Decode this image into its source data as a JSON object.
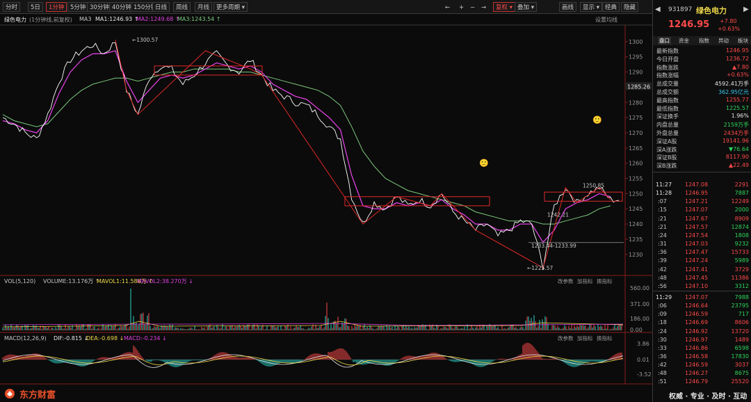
{
  "toolbar": {
    "periods": [
      "分时",
      "5日",
      "1分钟",
      "5分钟",
      "30分钟",
      "40分钟",
      "150分钟",
      "日线",
      "周线",
      "月线",
      "更多周期"
    ],
    "active_period": "1分钟",
    "right_buttons": [
      "复权",
      "叠加",
      "画线",
      "显示",
      "经典",
      "隐藏"
    ],
    "active_right": "复权"
  },
  "header": {
    "name": "绿色电力",
    "subtitle": "(1分钟线,前复权)",
    "ma": [
      {
        "label": "MA3",
        "value": ""
      },
      {
        "label": "MA1:",
        "value": "1246.93"
      },
      {
        "label": "MA2:",
        "value": "1249.68"
      },
      {
        "label": "MA3:",
        "value": "1243.54"
      }
    ],
    "settings": "设置均线"
  },
  "chart_data": [
    {
      "type": "line",
      "title": "绿色电力",
      "ylim": [
        1225,
        1303
      ],
      "yticks": [
        1300,
        1295,
        1290,
        1285,
        1280,
        1275,
        1270,
        1265,
        1260,
        1255,
        1250,
        1245,
        1240,
        1235,
        1230
      ],
      "price_label": "1285.26",
      "annotations": [
        "1300.57",
        "1225.57",
        "1233.44-1233.99",
        "1250.85",
        "1242.21"
      ],
      "emoji_marks": [
        "🙂",
        "🙂"
      ],
      "series": [
        {
          "name": "MA1",
          "color": "#ffffff"
        },
        {
          "name": "MA2",
          "color": "#e040e0"
        },
        {
          "name": "MA3",
          "color": "#7cc97c"
        }
      ],
      "price_path": [
        1275,
        1273,
        1270,
        1268,
        1276,
        1287,
        1294,
        1297,
        1299,
        1296,
        1300,
        1284,
        1276,
        1288,
        1292,
        1291,
        1286,
        1289,
        1293,
        1296,
        1292,
        1290,
        1294,
        1289,
        1284,
        1282,
        1280,
        1279,
        1276,
        1272,
        1268,
        1249,
        1240,
        1247,
        1245,
        1249,
        1246,
        1248,
        1246,
        1250,
        1244,
        1241,
        1238,
        1240,
        1236,
        1238,
        1241,
        1240,
        1226,
        1246,
        1252,
        1247,
        1250,
        1252,
        1248
      ],
      "ma2_path": [
        1274,
        1273,
        1271,
        1270,
        1274,
        1283,
        1290,
        1294,
        1296,
        1296,
        1297,
        1287,
        1280,
        1284,
        1288,
        1289,
        1288,
        1289,
        1291,
        1293,
        1292,
        1291,
        1292,
        1290,
        1286,
        1284,
        1282,
        1281,
        1278,
        1275,
        1271,
        1256,
        1246,
        1245,
        1245,
        1247,
        1246,
        1247,
        1246,
        1248,
        1245,
        1243,
        1240,
        1240,
        1238,
        1238,
        1240,
        1240,
        1234,
        1238,
        1245,
        1247,
        1248,
        1250,
        1249
      ],
      "ma3_path": [
        1276,
        1274,
        1273,
        1272,
        1273,
        1277,
        1281,
        1284,
        1286,
        1287,
        1288,
        1288,
        1287,
        1288,
        1289,
        1290,
        1290,
        1291,
        1291,
        1291,
        1291,
        1290,
        1290,
        1289,
        1288,
        1287,
        1286,
        1285,
        1284,
        1282,
        1279,
        1272,
        1264,
        1259,
        1255,
        1253,
        1251,
        1250,
        1249,
        1248,
        1247,
        1246,
        1244,
        1243,
        1242,
        1241,
        1241,
        1241,
        1240,
        1240,
        1241,
        1242,
        1243,
        1245,
        1246
      ]
    },
    {
      "type": "bar",
      "title": "VOL(5,120)",
      "legend": [
        {
          "label": "VOLUME:",
          "value": "13.176万",
          "color": "#c8c8c8"
        },
        {
          "label": "MAVOL1:",
          "value": "11.586万",
          "color": "#f0d94a"
        },
        {
          "label": "MAVOL2:",
          "value": "38.270万",
          "color": "#e040e0"
        }
      ],
      "yticks": [
        "560.00",
        "371.00",
        "186.00",
        "0.00"
      ],
      "tools": [
        "改参数",
        "加指标",
        "换指标"
      ]
    },
    {
      "type": "bar",
      "title": "MACD(12,26,9)",
      "legend": [
        {
          "label": "DIF:",
          "value": "-0.815",
          "color": "#e8e8e8"
        },
        {
          "label": "DEA:",
          "value": "-0.698",
          "color": "#f0d94a"
        },
        {
          "label": "MACD:",
          "value": "-0.234",
          "color": "#e040e0"
        }
      ],
      "yticks": [
        "3.86",
        "0.01",
        "-3.52"
      ],
      "tools": [
        "改参数",
        "加指标",
        "换指标"
      ]
    }
  ],
  "quote": {
    "code": "931897",
    "name": "绿色电力",
    "price": "1246.95",
    "change": "+7.80",
    "change_pct": "+0.63%",
    "tabs": [
      "盘口",
      "资金",
      "指数",
      "异动",
      "板块"
    ],
    "rows": [
      {
        "k": "最新指数",
        "v": "1246.95",
        "c": "red"
      },
      {
        "k": "今日开盘",
        "v": "1236.72",
        "c": "red"
      },
      {
        "k": "指数涨跌",
        "v": "▲7.80",
        "c": "red"
      },
      {
        "k": "指数涨幅",
        "v": "+0.63%",
        "c": "red"
      },
      {
        "k": "总成交量",
        "v": "4592.41万手",
        "c": "white"
      },
      {
        "k": "总成交额",
        "v": "362.95亿元",
        "c": "cyan"
      },
      {
        "k": "最高指数",
        "v": "1255.77",
        "c": "red"
      },
      {
        "k": "最低指数",
        "v": "1225.57",
        "c": "green"
      },
      {
        "k": "深证换手",
        "v": "1.96%",
        "c": "white"
      },
      {
        "k": "内盘总量",
        "v": "2159万手",
        "c": "green"
      },
      {
        "k": "外盘总量",
        "v": "2434万手",
        "c": "red"
      },
      {
        "k": "深证A股",
        "v": "19141.96",
        "c": "red"
      },
      {
        "k": "深A涨跌",
        "v": "▼76.64",
        "c": "green"
      },
      {
        "k": "深证B股",
        "v": "8117.90",
        "c": "red"
      },
      {
        "k": "深B涨跌",
        "v": "▲22.49",
        "c": "red"
      }
    ],
    "ticks": [
      {
        "t": "11:27",
        "p": "1247.08",
        "q": "2291",
        "c": "red"
      },
      {
        "t": "11:28",
        "p": "1246.95",
        "q": "7887",
        "c": "green"
      },
      {
        "t": ":07",
        "p": "1247.21",
        "q": "12249",
        "c": "red"
      },
      {
        "t": ":15",
        "p": "1247.07",
        "q": "2000",
        "c": "green"
      },
      {
        "t": ":21",
        "p": "1247.67",
        "q": "8909",
        "c": "red"
      },
      {
        "t": ":21",
        "p": "1247.57",
        "q": "12874",
        "c": "green"
      },
      {
        "t": ":24",
        "p": "1247.54",
        "q": "1808",
        "c": "green"
      },
      {
        "t": ":31",
        "p": "1247.03",
        "q": "9232",
        "c": "green"
      },
      {
        "t": ":36",
        "p": "1247.47",
        "q": "15733",
        "c": "red"
      },
      {
        "t": ":39",
        "p": "1247.24",
        "q": "5989",
        "c": "green"
      },
      {
        "t": ":42",
        "p": "1247.41",
        "q": "3729",
        "c": "red"
      },
      {
        "t": ":48",
        "p": "1247.45",
        "q": "11386",
        "c": "red"
      },
      {
        "t": ":56",
        "p": "1247.10",
        "q": "3312",
        "c": "green"
      },
      {
        "t": "11:29",
        "p": "1247.07",
        "q": "7988",
        "c": "green"
      },
      {
        "t": ":06",
        "p": "1246.64",
        "q": "23795",
        "c": "green"
      },
      {
        "t": ":09",
        "p": "1246.59",
        "q": "717",
        "c": "green"
      },
      {
        "t": ":18",
        "p": "1246.69",
        "q": "8606",
        "c": "red"
      },
      {
        "t": ":24",
        "p": "1246.92",
        "q": "13720",
        "c": "red"
      },
      {
        "t": ":30",
        "p": "1246.97",
        "q": "1489",
        "c": "red"
      },
      {
        "t": ":33",
        "p": "1246.86",
        "q": "6598",
        "c": "green"
      },
      {
        "t": ":36",
        "p": "1246.58",
        "q": "17830",
        "c": "green"
      },
      {
        "t": ":42",
        "p": "1246.59",
        "q": "3037",
        "c": "red"
      },
      {
        "t": ":48",
        "p": "1246.27",
        "q": "8675",
        "c": "green"
      },
      {
        "t": ":51",
        "p": "1246.79",
        "q": "25520",
        "c": "red"
      }
    ]
  },
  "footer": {
    "logo": "东方财富",
    "slogan": "权威 · 专业 · 及时 · 互动"
  }
}
